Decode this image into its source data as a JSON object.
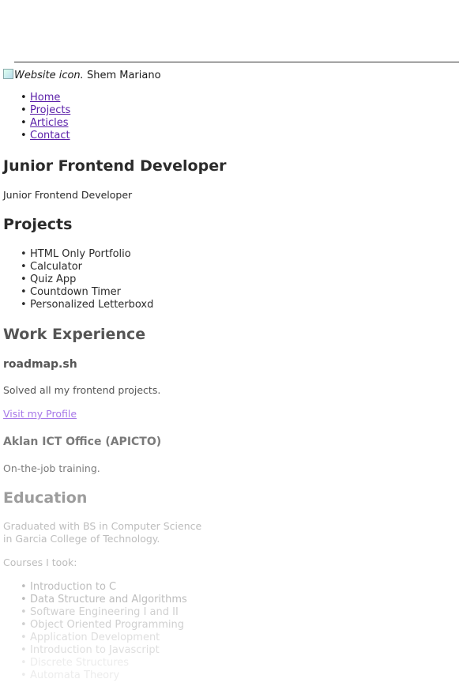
{
  "header": {
    "logo_alt": "Website icon.",
    "site_name": "Shem Mariano"
  },
  "nav": {
    "items": [
      {
        "label": "Home"
      },
      {
        "label": "Projects"
      },
      {
        "label": "Articles"
      },
      {
        "label": "Contact"
      }
    ]
  },
  "hero": {
    "title": "Junior Frontend Developer",
    "subtitle": "Junior Frontend Developer"
  },
  "projects": {
    "heading": "Projects",
    "items": [
      "HTML Only Portfolio",
      "Calculator",
      "Quiz App",
      "Countdown Timer",
      "Personalized Letterboxd"
    ]
  },
  "work": {
    "heading": "Work Experience",
    "jobs": [
      {
        "company": "roadmap.sh",
        "description": "Solved all my frontend projects.",
        "link": "Visit my Profile"
      },
      {
        "company": "Aklan ICT Office (APICTO)",
        "description": "On-the-job training."
      }
    ]
  },
  "education": {
    "heading": "Education",
    "summary_line1": "Graduated with BS in Computer Science",
    "summary_line2": "in Garcia College of Technology.",
    "courses_label": "Courses I took:",
    "courses": [
      "Introduction to C",
      "Data Structure and Algorithms",
      "Software Engineering I and II",
      "Object Oriented Programming",
      "Application Development",
      "Introduction to Javascript",
      "Discrete Structures",
      "Automata Theory"
    ]
  }
}
